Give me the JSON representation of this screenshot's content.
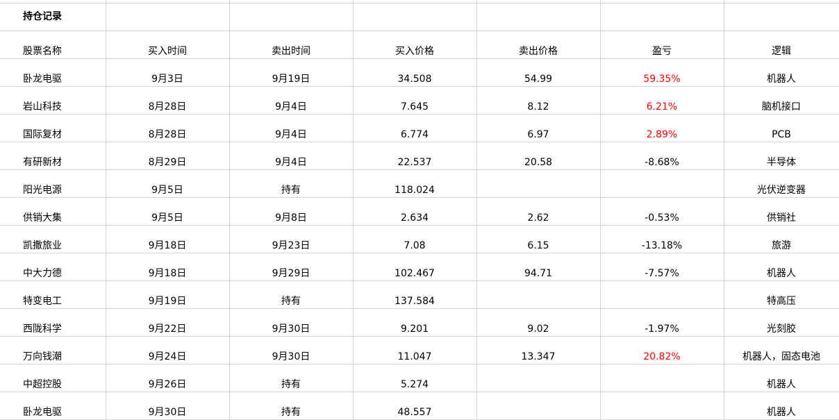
{
  "sheet": {
    "title": "持仓记录",
    "columns": [
      "股票名称",
      "买入时间",
      "卖出时间",
      "买入价格",
      "卖出价格",
      "盈亏",
      "逻辑"
    ],
    "colors": {
      "gain": "#ff0000",
      "loss": "#000000",
      "gridline": "#d4d4d4"
    },
    "rows": [
      {
        "name": "卧龙电驱",
        "buy_date": "9月3日",
        "sell_date": "9月19日",
        "buy_price": "34.508",
        "sell_price": "54.99",
        "pnl": "59.35%",
        "pnl_sign": "gain",
        "logic": "机器人"
      },
      {
        "name": "岩山科技",
        "buy_date": "8月28日",
        "sell_date": "9月4日",
        "buy_price": "7.645",
        "sell_price": "8.12",
        "pnl": "6.21%",
        "pnl_sign": "gain",
        "logic": "脑机接口"
      },
      {
        "name": "国际复材",
        "buy_date": "8月28日",
        "sell_date": "9月4日",
        "buy_price": "6.774",
        "sell_price": "6.97",
        "pnl": "2.89%",
        "pnl_sign": "gain",
        "logic": "PCB"
      },
      {
        "name": "有研新材",
        "buy_date": "8月29日",
        "sell_date": "9月4日",
        "buy_price": "22.537",
        "sell_price": "20.58",
        "pnl": "-8.68%",
        "pnl_sign": "loss",
        "logic": "半导体"
      },
      {
        "name": "阳光电源",
        "buy_date": "9月5日",
        "sell_date": "持有",
        "buy_price": "118.024",
        "sell_price": "",
        "pnl": "",
        "pnl_sign": "loss",
        "logic": "光伏逆变器"
      },
      {
        "name": "供销大集",
        "buy_date": "9月5日",
        "sell_date": "9月8日",
        "buy_price": "2.634",
        "sell_price": "2.62",
        "pnl": "-0.53%",
        "pnl_sign": "loss",
        "logic": "供销社"
      },
      {
        "name": "凯撒旅业",
        "buy_date": "9月18日",
        "sell_date": "9月23日",
        "buy_price": "7.08",
        "sell_price": "6.15",
        "pnl": "-13.18%",
        "pnl_sign": "loss",
        "logic": "旅游"
      },
      {
        "name": "中大力德",
        "buy_date": "9月18日",
        "sell_date": "9月29日",
        "buy_price": "102.467",
        "sell_price": "94.71",
        "pnl": "-7.57%",
        "pnl_sign": "loss",
        "logic": "机器人"
      },
      {
        "name": "特变电工",
        "buy_date": "9月19日",
        "sell_date": "持有",
        "buy_price": "137.584",
        "sell_price": "",
        "pnl": "",
        "pnl_sign": "loss",
        "logic": "特高压"
      },
      {
        "name": "西陇科学",
        "buy_date": "9月22日",
        "sell_date": "9月30日",
        "buy_price": "9.201",
        "sell_price": "9.02",
        "pnl": "-1.97%",
        "pnl_sign": "loss",
        "logic": "光刻胶"
      },
      {
        "name": "万向钱潮",
        "buy_date": "9月24日",
        "sell_date": "9月30日",
        "buy_price": "11.047",
        "sell_price": "13.347",
        "pnl": "20.82%",
        "pnl_sign": "gain",
        "logic": "机器人，固态电池"
      },
      {
        "name": "中超控股",
        "buy_date": "9月26日",
        "sell_date": "持有",
        "buy_price": "5.274",
        "sell_price": "",
        "pnl": "",
        "pnl_sign": "loss",
        "logic": "机器人"
      },
      {
        "name": "卧龙电驱",
        "buy_date": "9月30日",
        "sell_date": "持有",
        "buy_price": "48.557",
        "sell_price": "",
        "pnl": "",
        "pnl_sign": "loss",
        "logic": "机器人"
      }
    ]
  }
}
